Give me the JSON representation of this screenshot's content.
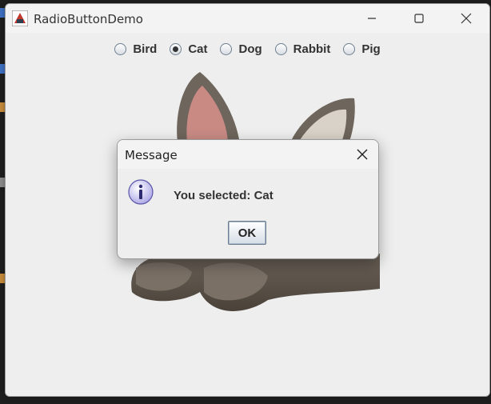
{
  "window": {
    "title": "RadioButtonDemo"
  },
  "titlebar_buttons": [
    "minimize-icon",
    "maximize-icon",
    "close-icon"
  ],
  "options": [
    {
      "label": "Bird",
      "selected": false
    },
    {
      "label": "Cat",
      "selected": true
    },
    {
      "label": "Dog",
      "selected": false
    },
    {
      "label": "Rabbit",
      "selected": false
    },
    {
      "label": "Pig",
      "selected": false
    }
  ],
  "image": {
    "subject": "cat"
  },
  "dialog": {
    "title": "Message",
    "icon": "info-icon",
    "message": "You selected: Cat",
    "ok_label": "OK"
  },
  "colors": {
    "window_bg": "#eeeeee",
    "titlebar_bg": "#f3f3f3",
    "desktop_bg": "#1e1e1e"
  }
}
